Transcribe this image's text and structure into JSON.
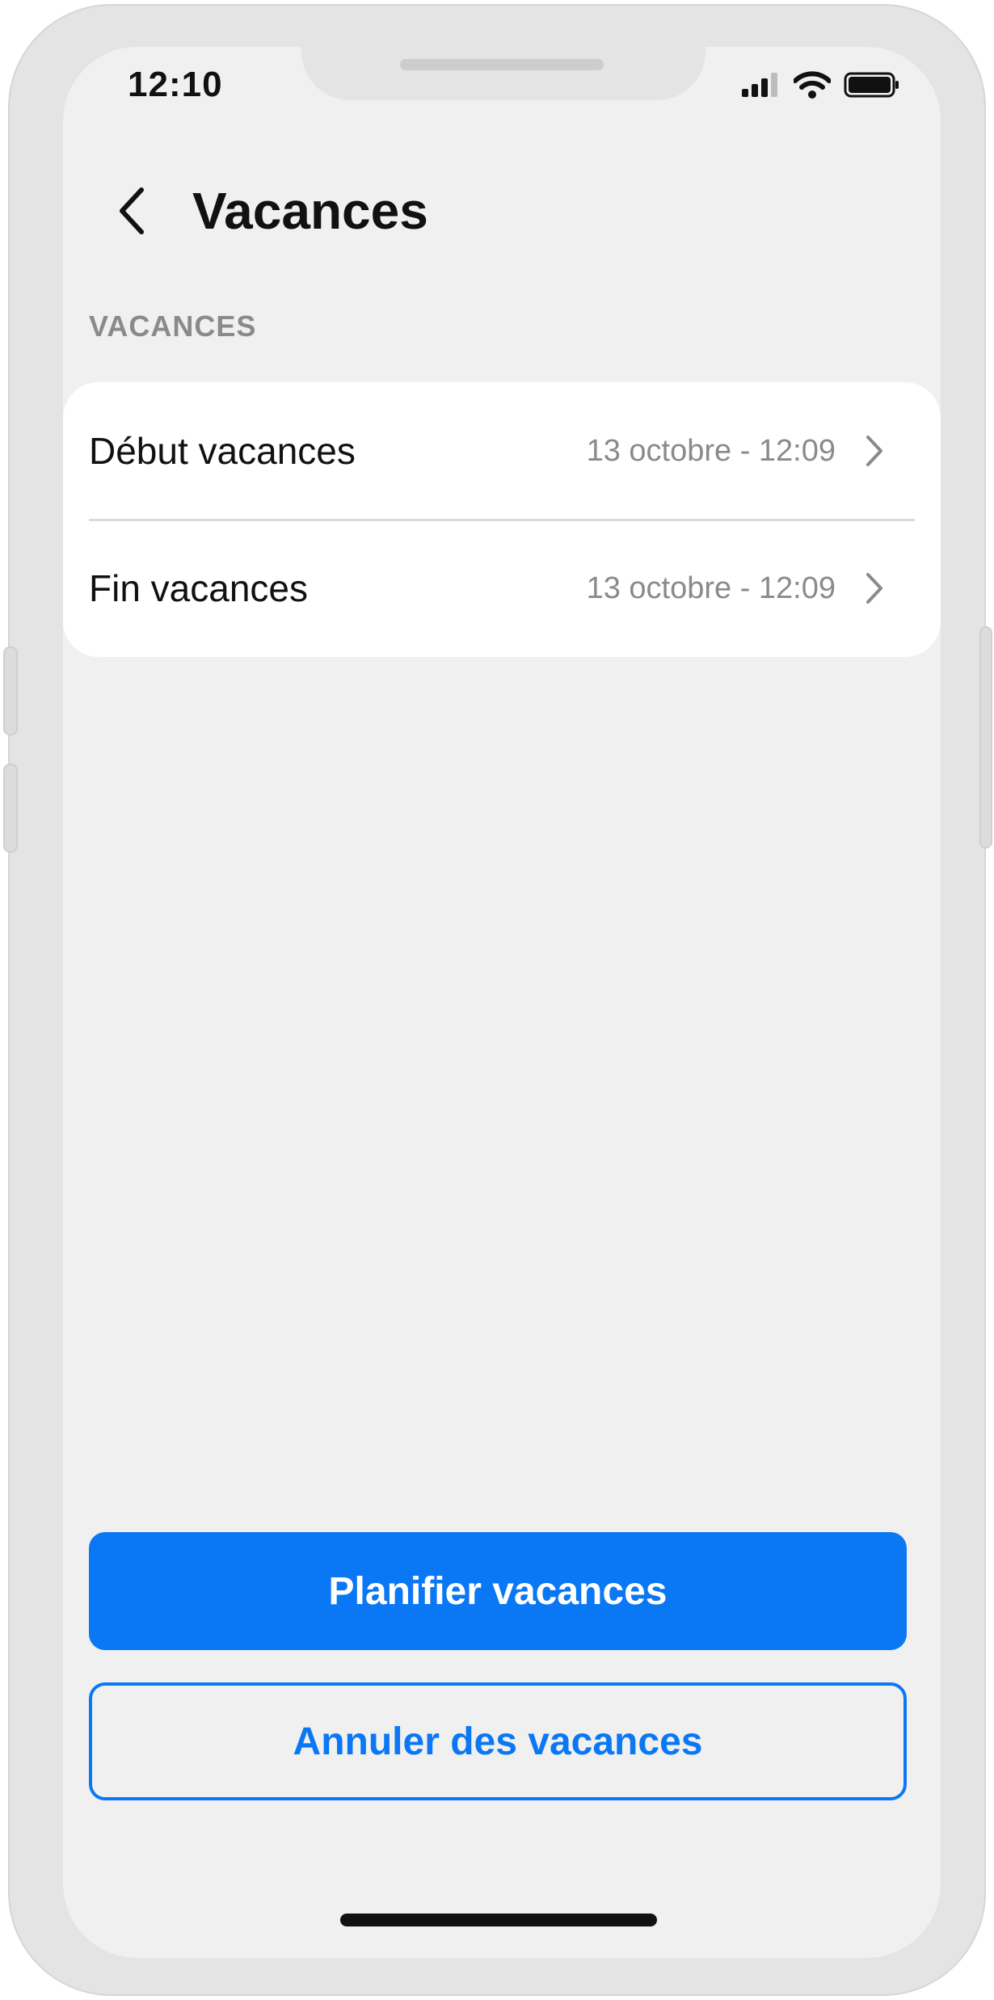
{
  "status_bar": {
    "time": "12:10"
  },
  "header": {
    "title": "Vacances"
  },
  "section": {
    "label": "VACANCES"
  },
  "rows": [
    {
      "label": "Début vacances",
      "value": "13 octobre - 12:09"
    },
    {
      "label": "Fin vacances",
      "value": "13 octobre - 12:09"
    }
  ],
  "actions": {
    "primary_label": "Planifier vacances",
    "secondary_label": "Annuler des vacances"
  },
  "icons": {
    "back": "chevron-left-icon",
    "row_chevron": "chevron-right-icon",
    "signal": "cellular-signal-icon",
    "wifi": "wifi-icon",
    "battery": "battery-icon"
  },
  "colors": {
    "accent": "#0a78f5",
    "background": "#f0f0f0",
    "card": "#ffffff",
    "secondary_text": "#8a8a8a"
  }
}
